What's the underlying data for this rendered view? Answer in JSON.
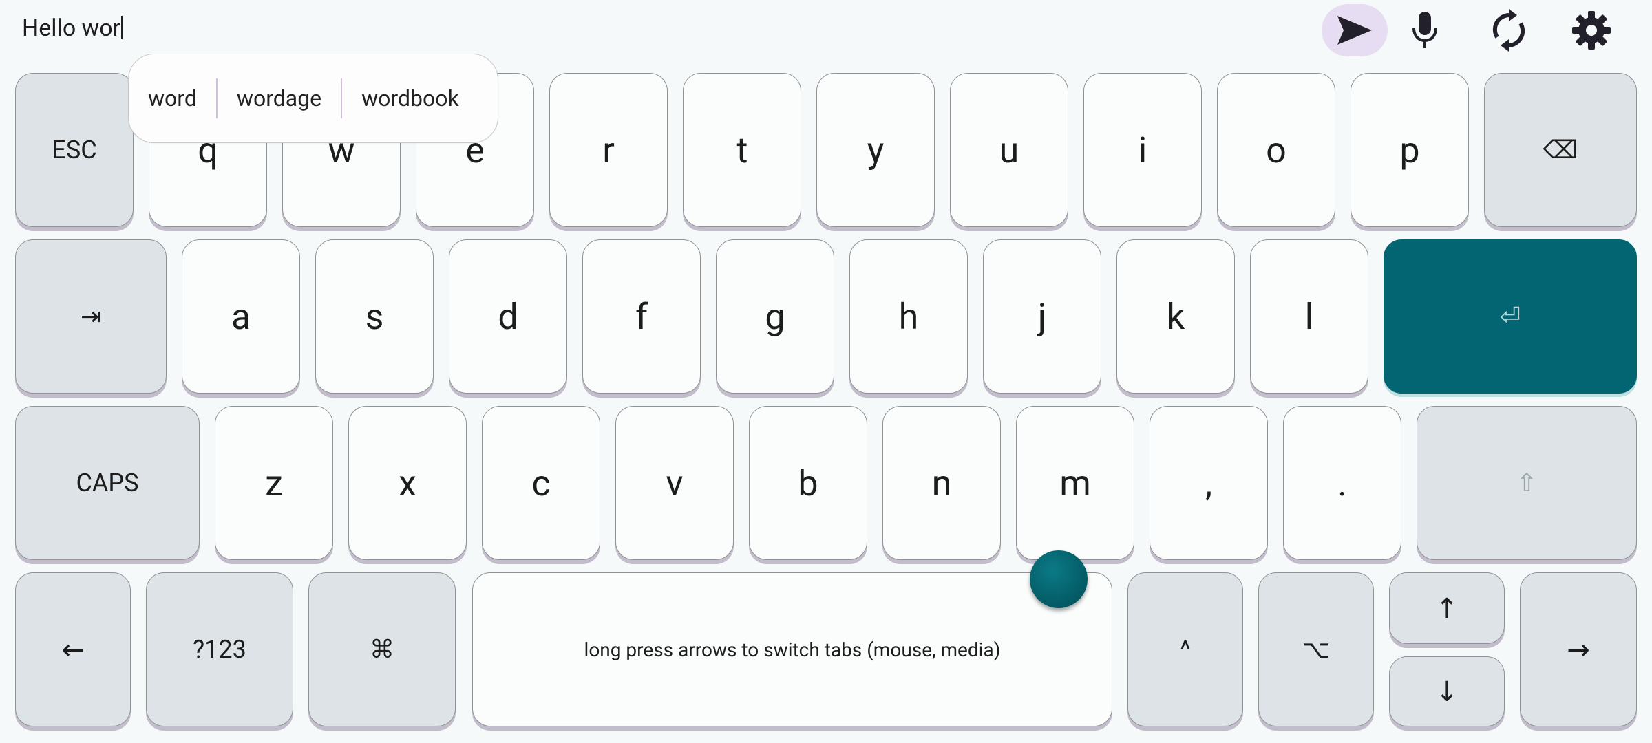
{
  "input": {
    "text": "Hello wor"
  },
  "toolbar": {
    "icons": [
      "send-icon",
      "mic-icon",
      "sync-icon",
      "gear-icon"
    ],
    "send_bg": "#e7ddf3",
    "icon_color": "#22202a"
  },
  "suggestions": [
    "word",
    "wordage",
    "wordbook"
  ],
  "keys": {
    "row1": [
      "ESC",
      "q",
      "w",
      "e",
      "r",
      "t",
      "y",
      "u",
      "i",
      "o",
      "p",
      "⌫"
    ],
    "row2": [
      "⇥",
      "a",
      "s",
      "d",
      "f",
      "g",
      "h",
      "j",
      "k",
      "l",
      "⏎"
    ],
    "row3": [
      "CAPS",
      "z",
      "x",
      "c",
      "v",
      "b",
      "n",
      "m",
      ",",
      ".",
      "⇧"
    ],
    "row4": [
      "←",
      "?123",
      "⌘",
      "long press arrows to switch tabs (mouse, media)",
      "^",
      "⌥",
      "↑",
      "↓",
      "→"
    ]
  },
  "colors": {
    "background": "#f6f9f9",
    "key": "#fbfcfc",
    "modifier": "#dde3e6",
    "enter": "#036572",
    "key_shadow": "#c3bccb"
  }
}
